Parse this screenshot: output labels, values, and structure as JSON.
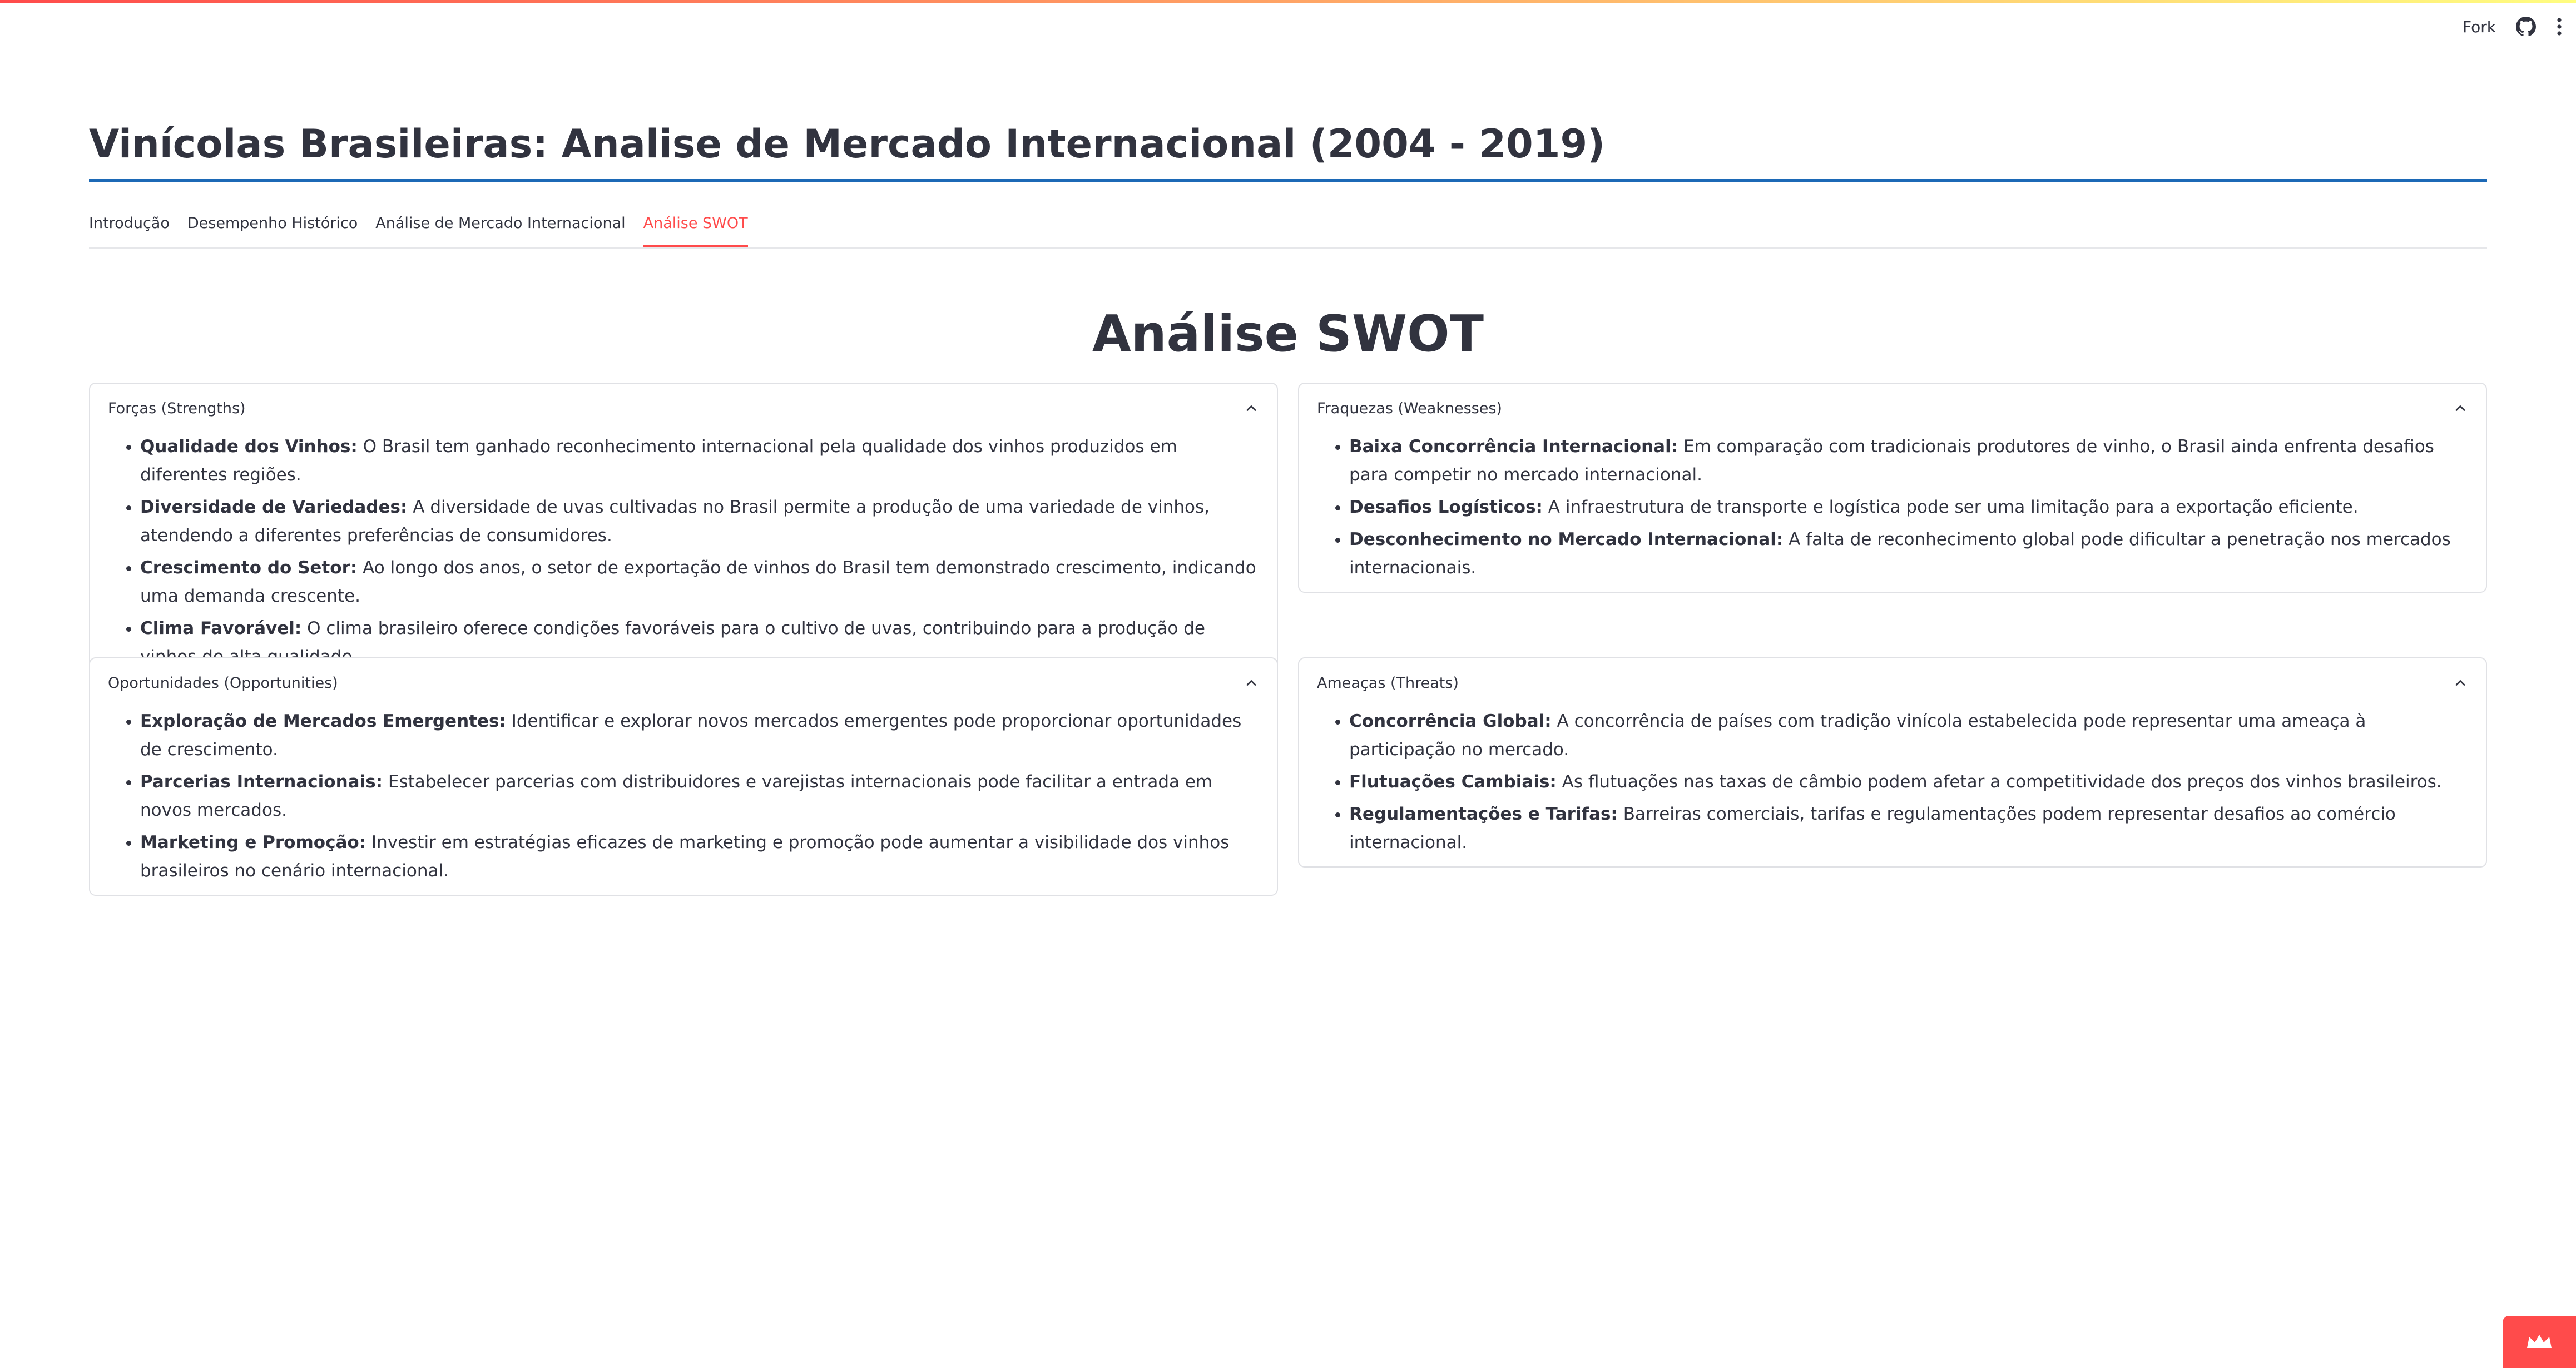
{
  "toolbar": {
    "fork_label": "Fork",
    "icons": [
      "github-icon",
      "more-vertical-icon"
    ]
  },
  "page": {
    "title": "Vinícolas Brasileiras: Analise de Mercado Internacional (2004 - 2019)"
  },
  "tabs": [
    {
      "label": "Introdução",
      "active": false
    },
    {
      "label": "Desempenho Histórico",
      "active": false
    },
    {
      "label": "Análise de Mercado Internacional",
      "active": false
    },
    {
      "label": "Análise SWOT",
      "active": true
    }
  ],
  "main": {
    "heading": "Análise SWOT"
  },
  "swot": {
    "strengths": {
      "title": "Forças (Strengths)",
      "items": [
        {
          "term": "Qualidade dos Vinhos:",
          "text": " O Brasil tem ganhado reconhecimento internacional pela qualidade dos vinhos produzidos em diferentes regiões."
        },
        {
          "term": "Diversidade de Variedades:",
          "text": " A diversidade de uvas cultivadas no Brasil permite a produção de uma variedade de vinhos, atendendo a diferentes preferências de consumidores."
        },
        {
          "term": "Crescimento do Setor:",
          "text": " Ao longo dos anos, o setor de exportação de vinhos do Brasil tem demonstrado crescimento, indicando uma demanda crescente."
        },
        {
          "term": "Clima Favorável:",
          "text": " O clima brasileiro oferece condições favoráveis para o cultivo de uvas, contribuindo para a produção de vinhos de alta qualidade."
        }
      ]
    },
    "weaknesses": {
      "title": "Fraquezas (Weaknesses)",
      "items": [
        {
          "term": "Baixa Concorrência Internacional:",
          "text": " Em comparação com tradicionais produtores de vinho, o Brasil ainda enfrenta desafios para competir no mercado internacional."
        },
        {
          "term": "Desafios Logísticos:",
          "text": " A infraestrutura de transporte e logística pode ser uma limitação para a exportação eficiente."
        },
        {
          "term": "Desconhecimento no Mercado Internacional:",
          "text": " A falta de reconhecimento global pode dificultar a penetração nos mercados internacionais."
        }
      ]
    },
    "opportunities": {
      "title": "Oportunidades (Opportunities)",
      "items": [
        {
          "term": "Exploração de Mercados Emergentes:",
          "text": " Identificar e explorar novos mercados emergentes pode proporcionar oportunidades de crescimento."
        },
        {
          "term": "Parcerias Internacionais:",
          "text": " Estabelecer parcerias com distribuidores e varejistas internacionais pode facilitar a entrada em novos mercados."
        },
        {
          "term": "Marketing e Promoção:",
          "text": " Investir em estratégias eficazes de marketing e promoção pode aumentar a visibilidade dos vinhos brasileiros no cenário internacional."
        }
      ]
    },
    "threats": {
      "title": "Ameaças (Threats)",
      "items": [
        {
          "term": "Concorrência Global:",
          "text": " A concorrência de países com tradição vinícola estabelecida pode representar uma ameaça à participação no mercado."
        },
        {
          "term": "Flutuações Cambiais:",
          "text": " As flutuações nas taxas de câmbio podem afetar a competitividade dos preços dos vinhos brasileiros."
        },
        {
          "term": "Regulamentações e Tarifas:",
          "text": " Barreiras comerciais, tarifas e regulamentações podem representar desafios ao comércio internacional."
        }
      ]
    }
  },
  "colors": {
    "accent": "#ff4b4b",
    "title_rule": "#1c69b6",
    "text": "#31333f",
    "border": "#e0e1e5"
  }
}
